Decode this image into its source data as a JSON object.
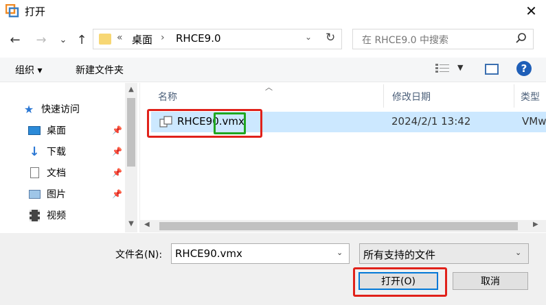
{
  "window": {
    "title": "打开",
    "close_glyph": "✕"
  },
  "nav": {
    "back_glyph": "←",
    "forward_glyph": "→",
    "recent_glyph": "⌄",
    "up_glyph": "↑",
    "breadcrumb_sep": "«",
    "breadcrumb": [
      "桌面",
      "RHCE9.0"
    ],
    "crumb_arrow": "›",
    "refresh_glyph": "↻",
    "search_placeholder": "在 RHCE9.0 中搜索"
  },
  "toolbar": {
    "organize": "组织 ▾",
    "new_folder": "新建文件夹",
    "help": "?"
  },
  "sidebar": {
    "items": [
      {
        "label": "快速访问",
        "icon": "star-icon"
      },
      {
        "label": "桌面",
        "icon": "desktop-icon",
        "pinned": true
      },
      {
        "label": "下载",
        "icon": "download-icon",
        "pinned": true
      },
      {
        "label": "文档",
        "icon": "document-icon",
        "pinned": true
      },
      {
        "label": "图片",
        "icon": "picture-icon",
        "pinned": true
      },
      {
        "label": "视频",
        "icon": "video-icon"
      }
    ]
  },
  "filelist": {
    "columns": [
      "名称",
      "修改日期",
      "类型"
    ],
    "rows": [
      {
        "name_base": "RHCE90",
        "name_ext": ".vmx",
        "modified": "2024/2/1 13:42",
        "type": "VMw"
      }
    ]
  },
  "bottom": {
    "filename_label": "文件名(N):",
    "filename_value": "RHCE90.vmx",
    "filter_value": "所有支持的文件",
    "open_label": "打开(O)",
    "cancel_label": "取消"
  },
  "colors": {
    "selection": "#cce8ff",
    "annotation_red": "#e0211a",
    "annotation_green": "#1fa61f",
    "accent": "#0078d7"
  }
}
